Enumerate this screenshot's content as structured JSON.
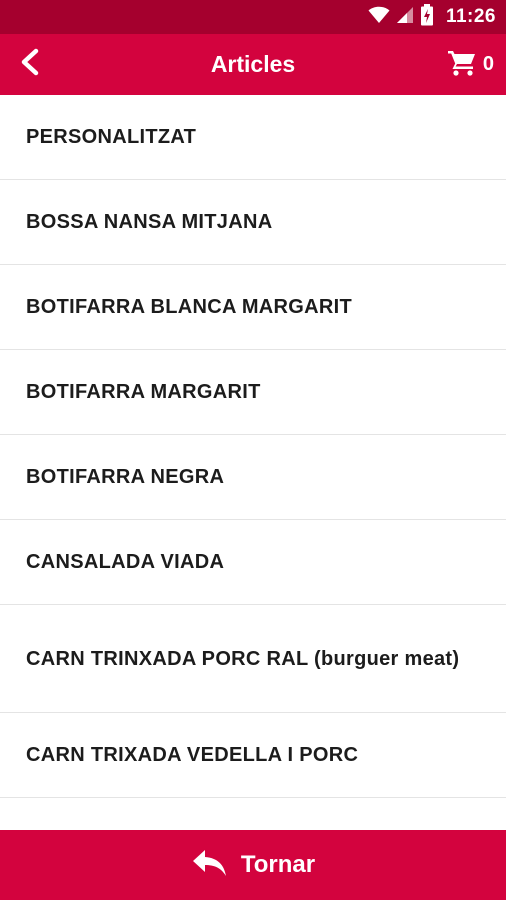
{
  "colors": {
    "status_bar": "#a5002e",
    "app_bar": "#d3033e",
    "bottom_bar": "#d3033e",
    "item_text": "#1c1c1c",
    "divider": "#e4e4e4"
  },
  "status_bar": {
    "time": "11:26",
    "icons": [
      "wifi-icon",
      "signal-icon",
      "battery-charging-icon"
    ]
  },
  "app_bar": {
    "back_icon": "chevron-left-icon",
    "title": "Articles",
    "cart_icon": "cart-icon",
    "cart_count": "0"
  },
  "articles": [
    {
      "label": "PERSONALITZAT"
    },
    {
      "label": "BOSSA NANSA MITJANA"
    },
    {
      "label": "BOTIFARRA BLANCA MARGARIT"
    },
    {
      "label": "BOTIFARRA MARGARIT"
    },
    {
      "label": "BOTIFARRA NEGRA"
    },
    {
      "label": "CANSALADA VIADA"
    },
    {
      "label": "CARN TRINXADA PORC RAL (burguer meat)"
    },
    {
      "label": "CARN TRIXADA VEDELLA I PORC"
    }
  ],
  "bottom_bar": {
    "icon": "reply-arrow-icon",
    "label": "Tornar"
  }
}
